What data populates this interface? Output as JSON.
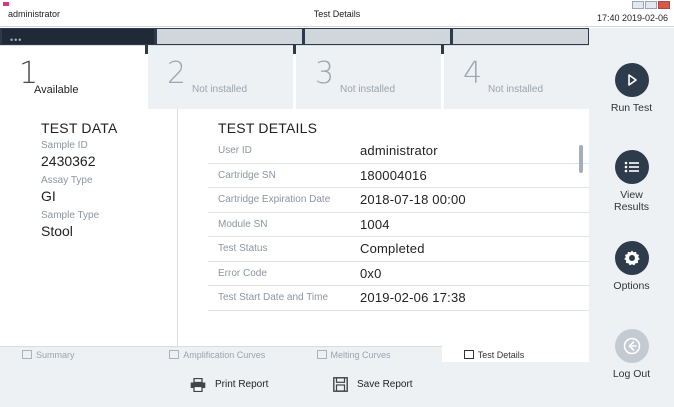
{
  "window": {
    "user": "administrator",
    "title": "Test Details",
    "datetime": "17:40 2019-02-06"
  },
  "modules": [
    {
      "number": "1",
      "status": "Available",
      "active": true
    },
    {
      "number": "2",
      "status": "Not installed",
      "active": false
    },
    {
      "number": "3",
      "status": "Not installed",
      "active": false
    },
    {
      "number": "4",
      "status": "Not installed",
      "active": false
    }
  ],
  "test_data": {
    "title": "TEST DATA",
    "sample_id_label": "Sample ID",
    "sample_id": "2430362",
    "assay_type_label": "Assay Type",
    "assay_type": "GI",
    "sample_type_label": "Sample Type",
    "sample_type": "Stool"
  },
  "test_details": {
    "title": "TEST DETAILS",
    "rows": [
      {
        "label": "User ID",
        "value": "administrator"
      },
      {
        "label": "Cartridge SN",
        "value": "180004016"
      },
      {
        "label": "Cartridge Expiration Date",
        "value": "2018-07-18 00:00"
      },
      {
        "label": "Module SN",
        "value": "1004"
      },
      {
        "label": "Test Status",
        "value": "Completed"
      },
      {
        "label": "Error Code",
        "value": "0x0"
      },
      {
        "label": "Test Start Date and Time",
        "value": "2019-02-06 17:38"
      }
    ]
  },
  "tabs": [
    {
      "label": "Summary",
      "icon": "summary-icon"
    },
    {
      "label": "Amplification Curves",
      "icon": "amplification-curve-icon"
    },
    {
      "label": "Melting Curves",
      "icon": "melting-curve-icon"
    },
    {
      "label": "Test Details",
      "icon": "document-icon"
    }
  ],
  "actions": {
    "print": "Print Report",
    "save": "Save Report"
  },
  "sidebar": {
    "run_test": "Run Test",
    "view_results": "View\nResults",
    "options": "Options",
    "log_out": "Log Out"
  },
  "colors": {
    "sidebar_circle": "#2e3b4b",
    "module_strip": "#2c3a4a",
    "logo_accent": "#d23a8b"
  }
}
